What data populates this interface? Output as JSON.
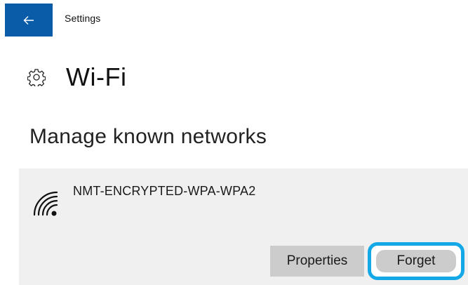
{
  "titlebar": {
    "back_icon": "arrow-left-icon",
    "app_title": "Settings"
  },
  "header": {
    "icon": "gear-icon",
    "title": "Wi-Fi"
  },
  "section": {
    "title": "Manage known networks"
  },
  "network": {
    "icon": "wifi-signal-icon",
    "name": "NMT-ENCRYPTED-WPA-WPA2",
    "properties_label": "Properties",
    "forget_label": "Forget"
  },
  "colors": {
    "accent": "#0a5ba8",
    "highlight": "#14a9e6",
    "card_background": "#f0f0f0",
    "button_background": "#cccccc"
  }
}
